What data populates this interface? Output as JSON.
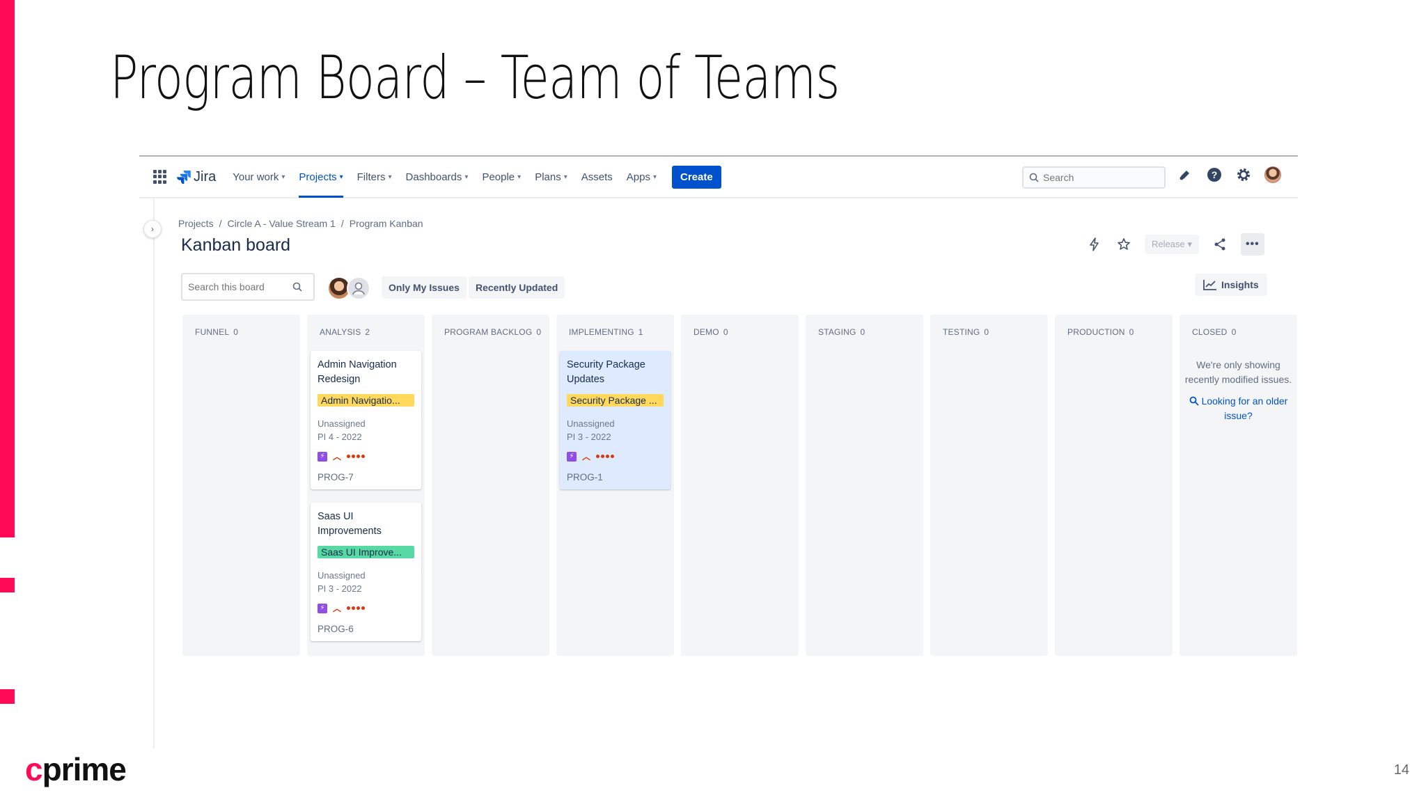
{
  "slide": {
    "title": "Program Board – Team of Teams",
    "logo_c": "c",
    "logo_rest": "prime",
    "page_number": "14",
    "accent_color": "#ff0a56"
  },
  "topnav": {
    "app_name": "Jira",
    "items": [
      {
        "label": "Your work",
        "has_menu": true
      },
      {
        "label": "Projects",
        "has_menu": true,
        "active": true
      },
      {
        "label": "Filters",
        "has_menu": true
      },
      {
        "label": "Dashboards",
        "has_menu": true
      },
      {
        "label": "People",
        "has_menu": true
      },
      {
        "label": "Plans",
        "has_menu": true
      },
      {
        "label": "Assets",
        "has_menu": false
      },
      {
        "label": "Apps",
        "has_menu": true
      }
    ],
    "create_label": "Create",
    "search_placeholder": "Search",
    "brand_color": "#0052cc"
  },
  "breadcrumb": [
    "Projects",
    "Circle A - Value Stream 1",
    "Program Kanban"
  ],
  "board": {
    "title": "Kanban board",
    "release_label": "Release",
    "search_placeholder": "Search this board",
    "filters": [
      "Only My Issues",
      "Recently Updated"
    ],
    "insights_label": "Insights"
  },
  "columns": [
    {
      "name": "FUNNEL",
      "count": "0"
    },
    {
      "name": "ANALYSIS",
      "count": "2"
    },
    {
      "name": "PROGRAM BACKLOG",
      "count": "0"
    },
    {
      "name": "IMPLEMENTING",
      "count": "1"
    },
    {
      "name": "DEMO",
      "count": "0"
    },
    {
      "name": "STAGING",
      "count": "0"
    },
    {
      "name": "TESTING",
      "count": "0"
    },
    {
      "name": "PRODUCTION",
      "count": "0"
    },
    {
      "name": "CLOSED",
      "count": "0"
    }
  ],
  "cards": {
    "prog7": {
      "title": "Admin Navigation Redesign",
      "epic": "Admin Navigatio...",
      "epic_color": "#ffd85c",
      "assignee": "Unassigned",
      "pi": "PI 4 - 2022",
      "key": "PROG-7"
    },
    "prog6": {
      "title": "Saas UI Improvements",
      "epic": "Saas UI Improve...",
      "epic_color": "#57d9a3",
      "assignee": "Unassigned",
      "pi": "PI 3 - 2022",
      "key": "PROG-6"
    },
    "prog1": {
      "title": "Security Package Updates",
      "epic": "Security Package ...",
      "epic_color": "#ffd85c",
      "assignee": "Unassigned",
      "pi": "PI 3 - 2022",
      "key": "PROG-1"
    }
  },
  "closed": {
    "message": "We're only showing recently modified issues.",
    "link": "Looking for an older issue?"
  }
}
